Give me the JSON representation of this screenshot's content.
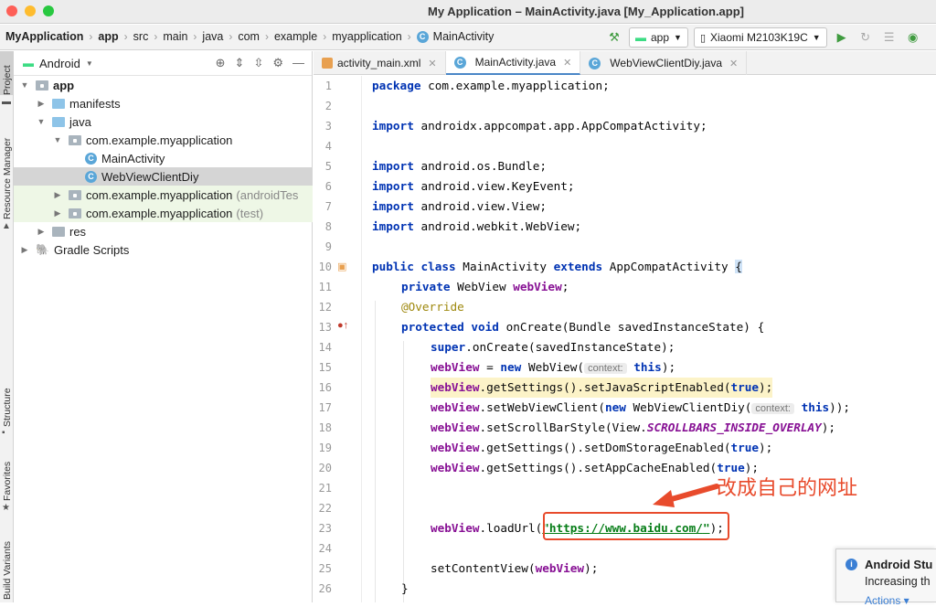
{
  "window": {
    "title": "My Application – MainActivity.java [My_Application.app]"
  },
  "breadcrumbs": [
    "MyApplication",
    "app",
    "src",
    "main",
    "java",
    "com",
    "example",
    "myapplication",
    "MainActivity"
  ],
  "toolbar": {
    "run_config": "app",
    "device": "Xiaomi M2103K19C"
  },
  "side_tabs": {
    "project": "Project",
    "resource_manager": "Resource Manager",
    "structure": "Structure",
    "favorites": "Favorites",
    "build_variants": "Build Variants"
  },
  "project_panel": {
    "view": "Android",
    "tree": [
      {
        "label": "app",
        "extra": ""
      },
      {
        "label": "manifests",
        "extra": ""
      },
      {
        "label": "java",
        "extra": ""
      },
      {
        "label": "com.example.myapplication",
        "extra": ""
      },
      {
        "label": "MainActivity",
        "extra": ""
      },
      {
        "label": "WebViewClientDiy",
        "extra": ""
      },
      {
        "label": "com.example.myapplication",
        "extra": "(androidTes"
      },
      {
        "label": "com.example.myapplication",
        "extra": "(test)"
      },
      {
        "label": "res",
        "extra": ""
      },
      {
        "label": "Gradle Scripts",
        "extra": ""
      }
    ]
  },
  "editor_tabs": [
    {
      "label": "activity_main.xml"
    },
    {
      "label": "MainActivity.java"
    },
    {
      "label": "WebViewClientDiy.java"
    }
  ],
  "code": {
    "line_numbers": [
      "1",
      "2",
      "3",
      "4",
      "5",
      "6",
      "7",
      "8",
      "9",
      "10",
      "11",
      "12",
      "13",
      "14",
      "15",
      "16",
      "17",
      "18",
      "19",
      "20",
      "21",
      "22",
      "23",
      "24",
      "25",
      "26"
    ],
    "l1_kw": "package",
    "l1_rest": " com.example.myapplication;",
    "l3_kw": "import",
    "l3_rest": " androidx.appcompat.app.AppCompatActivity;",
    "l5_kw": "import",
    "l5_rest": " android.os.Bundle;",
    "l6_kw": "import",
    "l6_rest": " android.view.KeyEvent;",
    "l7_kw": "import",
    "l7_rest": " android.view.View;",
    "l8_kw": "import",
    "l8_rest": " android.webkit.WebView;",
    "l10_kw1": "public class",
    "l10_name": " MainActivity ",
    "l10_kw2": "extends",
    "l10_rest": " AppCompatActivity ",
    "l10_brace": "{",
    "l11_kw": "private",
    "l11_type": " WebView ",
    "l11_field": "webView",
    "l11_end": ";",
    "l12_ann": "@Override",
    "l13_kw": "protected void",
    "l13_rest": " onCreate(Bundle savedInstanceState) {",
    "l14_kw": "super",
    "l14_rest": ".onCreate(savedInstanceState);",
    "l15_field": "webView",
    "l15_mid": " = ",
    "l15_kw": "new",
    "l15_rest": " WebView(",
    "l15_hint": "context:",
    "l15_this": "this",
    "l15_end": ");",
    "l16_field": "webView",
    "l16_rest": ".getSettings().setJavaScriptEnabled(",
    "l16_true": "true",
    "l16_end": ");",
    "l17_field": "webView",
    "l17_rest": ".setWebViewClient(",
    "l17_kw": "new",
    "l17_rest2": " WebViewClientDiy(",
    "l17_hint": "context:",
    "l17_this": "this",
    "l17_end": "));",
    "l18_field": "webView",
    "l18_rest": ".setScrollBarStyle(View.",
    "l18_const": "SCROLLBARS_INSIDE_OVERLAY",
    "l18_end": ");",
    "l19_field": "webView",
    "l19_rest": ".getSettings().setDomStorageEnabled(",
    "l19_true": "true",
    "l19_end": ");",
    "l20_field": "webView",
    "l20_rest": ".getSettings().setAppCacheEnabled(",
    "l20_true": "true",
    "l20_end": ");",
    "l23_field": "webView",
    "l23_rest": ".loadUrl(",
    "l23_q1": "\"",
    "l23_url": "https://www.baidu.com/",
    "l23_q2": "\"",
    "l23_end": ");",
    "l25_rest": "setContentView(",
    "l25_field": "webView",
    "l25_end": ");",
    "l26_rest": "}"
  },
  "annotation": {
    "text": "改成自己的网址",
    "color": "#e84b2c"
  },
  "notification": {
    "title": "Android Stu",
    "body": "Increasing th",
    "action": "Actions ▾"
  }
}
